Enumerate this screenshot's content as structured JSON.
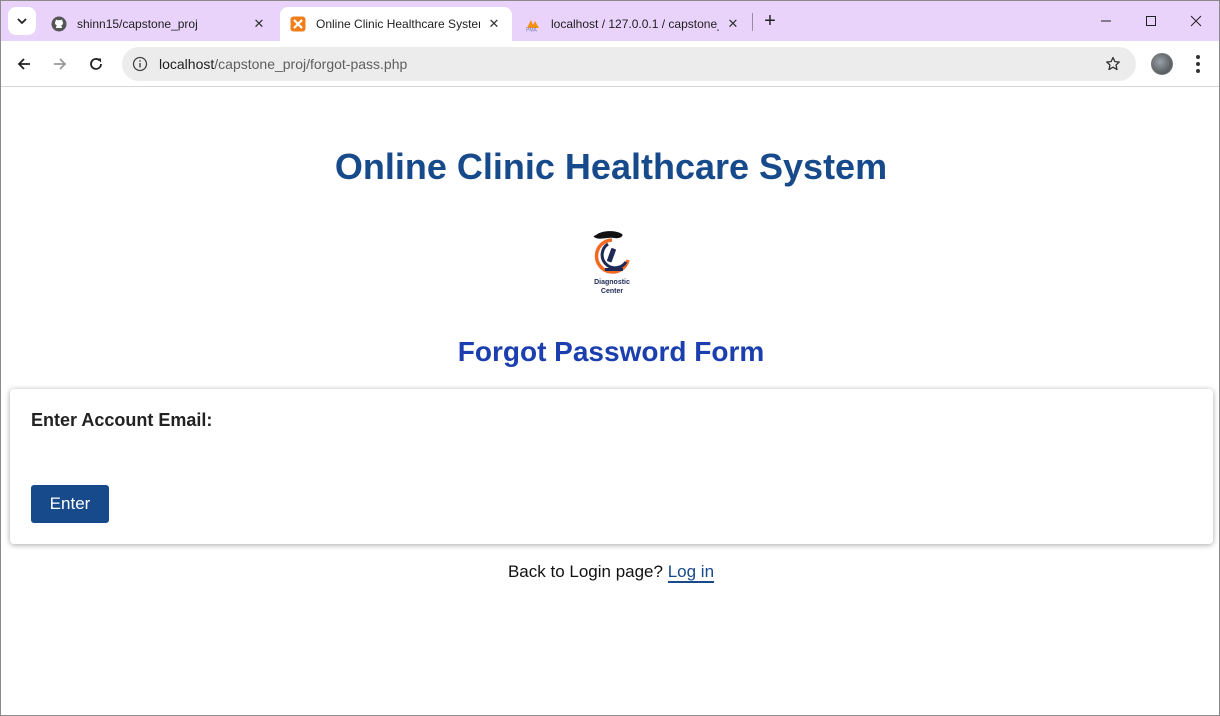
{
  "browser": {
    "tabs": [
      {
        "title": "shinn15/capstone_proj",
        "favicon": "github-icon",
        "active": false
      },
      {
        "title": "Online Clinic Healthcare System",
        "favicon": "xampp-icon",
        "active": true
      },
      {
        "title": "localhost / 127.0.0.1 / capstone_",
        "favicon": "phpmyadmin-icon",
        "active": false
      }
    ],
    "address": {
      "host": "localhost",
      "path": "/capstone_proj/forgot-pass.php"
    }
  },
  "page": {
    "site_title": "Online Clinic Healthcare System",
    "logo": {
      "line1": "Diagnostic",
      "line2": "Center"
    },
    "form_title": "Forgot Password Form",
    "email_label": "Enter Account Email:",
    "enter_button": "Enter",
    "back_text": "Back to Login page?",
    "login_link": "Log in"
  },
  "colors": {
    "tabstrip": "#e9d3fb",
    "primary": "#174a8b",
    "form_title": "#1b3fae"
  }
}
